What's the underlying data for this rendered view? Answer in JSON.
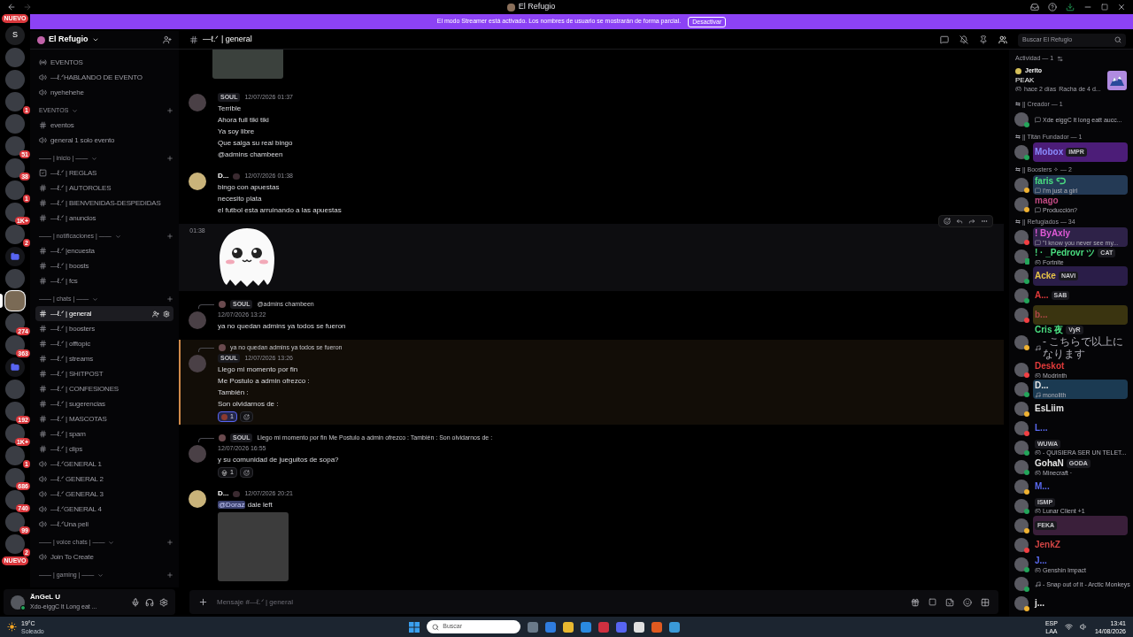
{
  "window": {
    "title": "El Refugio"
  },
  "banner": {
    "text": "El modo Streamer está activado. Los nombres de usuario se mostrarán de forma parcial.",
    "button": "Desactivar"
  },
  "rail": {
    "top_badge": "NUEVO",
    "bottom_badge": "NUEVO",
    "items": [
      {
        "kind": "letter",
        "label": "S",
        "selected": false
      },
      {
        "kind": "server",
        "selected": false
      },
      {
        "kind": "server",
        "selected": false
      },
      {
        "kind": "server",
        "badge": "1",
        "selected": false
      },
      {
        "kind": "server",
        "selected": false
      },
      {
        "kind": "server",
        "badge": "51",
        "selected": false
      },
      {
        "kind": "server",
        "badge": "38",
        "selected": false
      },
      {
        "kind": "server",
        "badge": "1",
        "selected": false
      },
      {
        "kind": "server",
        "badge": "1K+",
        "selected": false
      },
      {
        "kind": "server",
        "badge": "2",
        "selected": false
      },
      {
        "kind": "folder",
        "selected": false
      },
      {
        "kind": "server",
        "selected": false
      },
      {
        "kind": "server",
        "selected": true
      },
      {
        "kind": "server",
        "badge": "274",
        "selected": false
      },
      {
        "kind": "server",
        "badge": "363",
        "selected": false
      },
      {
        "kind": "folder",
        "selected": false
      },
      {
        "kind": "server",
        "selected": false
      },
      {
        "kind": "server",
        "badge": "192",
        "selected": false
      },
      {
        "kind": "server",
        "badge": "1K+",
        "selected": false
      },
      {
        "kind": "server",
        "badge": "1",
        "selected": false
      },
      {
        "kind": "server",
        "badge": "686",
        "selected": false
      },
      {
        "kind": "server",
        "badge": "740",
        "selected": false
      },
      {
        "kind": "server",
        "badge": "99",
        "selected": false
      },
      {
        "kind": "server",
        "badge": "2",
        "selected": false
      }
    ]
  },
  "sidebar": {
    "server_name": "El Refugio",
    "sections": [
      {
        "channels": [
          {
            "kind": "stage",
            "name": "EVENTOS",
            "selected": false
          },
          {
            "kind": "voice",
            "name": "—ℓ.ᐟHABLANDO DE EVENTO",
            "selected": false
          },
          {
            "kind": "voice",
            "name": "nyehehehe",
            "selected": false
          }
        ]
      },
      {
        "title": "EVENTOS",
        "channels": [
          {
            "kind": "text",
            "name": "eventos",
            "selected": false
          },
          {
            "kind": "voice",
            "name": "general 1 solo evento",
            "selected": false
          }
        ]
      },
      {
        "title": "—— | inicio | ——",
        "channels": [
          {
            "kind": "rules",
            "name": "—ℓ.ᐟ | REGLAS",
            "selected": false
          },
          {
            "kind": "text",
            "name": "—ℓ.ᐟ | AUTOROLES",
            "selected": false
          },
          {
            "kind": "text",
            "name": "—ℓ.ᐟ | BIENVENIDAS-DESPEDIDAS",
            "selected": false
          },
          {
            "kind": "text",
            "name": "—ℓ.ᐟ | anuncios",
            "selected": false
          }
        ]
      },
      {
        "title": "—— | notificaciones | ——",
        "channels": [
          {
            "kind": "text",
            "name": "—ℓ.ᐟ |encuesta",
            "selected": false
          },
          {
            "kind": "text",
            "name": "—ℓ.ᐟ | boosts",
            "selected": false
          },
          {
            "kind": "text",
            "name": "—ℓ.ᐟ | fcs",
            "selected": false
          }
        ]
      },
      {
        "title": "—— | chats | ——",
        "channels": [
          {
            "kind": "text",
            "name": "—ℓ.ᐟ | general",
            "selected": true
          },
          {
            "kind": "text",
            "name": "—ℓ.ᐟ | boosters",
            "selected": false
          },
          {
            "kind": "text",
            "name": "—ℓ.ᐟ | offtopic",
            "selected": false
          },
          {
            "kind": "text",
            "name": "—ℓ.ᐟ | streams",
            "selected": false
          },
          {
            "kind": "text",
            "name": "—ℓ.ᐟ | SHITPOST",
            "selected": false
          },
          {
            "kind": "text",
            "name": "—ℓ.ᐟ | CONFESIONES",
            "selected": false
          },
          {
            "kind": "text",
            "name": "—ℓ.ᐟ | sugerencias",
            "selected": false
          },
          {
            "kind": "text",
            "name": "—ℓ.ᐟ | MASCOTAS",
            "selected": false
          },
          {
            "kind": "text",
            "name": "—ℓ.ᐟ | spam",
            "selected": false
          },
          {
            "kind": "text",
            "name": "—ℓ.ᐟ | clips",
            "selected": false
          },
          {
            "kind": "voice",
            "name": "—ℓ.ᐟGENERAL 1",
            "selected": false
          },
          {
            "kind": "voice",
            "name": "—ℓ.ᐟ GENERAL 2",
            "selected": false
          },
          {
            "kind": "voice",
            "name": "—ℓ.ᐟ GENERAL 3",
            "selected": false
          },
          {
            "kind": "voice",
            "name": "—ℓ.ᐟGENERAL 4",
            "selected": false
          },
          {
            "kind": "voice",
            "name": "—ℓ.ᐟUna peli",
            "selected": false
          }
        ]
      },
      {
        "title": "—— | voice chats | ——",
        "channels": [
          {
            "kind": "voice",
            "name": "Join To Create",
            "selected": false
          }
        ]
      },
      {
        "title": "—— | gaming | ——"
      }
    ]
  },
  "user": {
    "name": "ÄnGeL U",
    "status": "Xdo-eiggC lt Long eat ..."
  },
  "chat": {
    "channel": "—ℓ.ᐟ | general",
    "placeholder": "Mensaje #—ℓ.ᐟ | general",
    "messages": [
      {
        "kind": "image"
      },
      {
        "kind": "message",
        "highlighted": false,
        "hovered": false,
        "tag": "SOUL",
        "time": "12/07/2026 01:37",
        "lines": [
          "Terrible",
          "Ahora full tiki tiki",
          "Ya soy libre",
          "Que salga su real bingo",
          "@admins chambeen"
        ]
      },
      {
        "kind": "message",
        "highlighted": false,
        "hovered": false,
        "author": "D...",
        "time": "12/07/2026 01:38",
        "lines": [
          "bingo con apuestas",
          "necesito plata",
          "el futbol esta arruinando a las apuestas"
        ]
      },
      {
        "kind": "sticker",
        "highlighted": false,
        "hovered": true,
        "time": "01:38"
      },
      {
        "kind": "message",
        "highlighted": false,
        "hovered": false,
        "reply": {
          "tag": "SOUL",
          "text": "@admins chambeen"
        },
        "time": "12/07/2026 13:22",
        "lines": [
          "ya no quedan admins ya todos se fueron"
        ]
      },
      {
        "kind": "message",
        "highlighted": true,
        "hovered": false,
        "reply": {
          "text": "ya no quedan admins ya todos se fueron"
        },
        "tag": "SOUL",
        "time": "12/07/2026 13:26",
        "lines": [
          "Llego mi momento por fin",
          "Me Postulo a admin ofrezco :",
          "También :",
          "Son olvidarnos de :"
        ],
        "reactions": [
          {
            "kind": "custom",
            "count": "1",
            "selected": true
          }
        ]
      },
      {
        "kind": "message",
        "highlighted": false,
        "hovered": false,
        "reply": {
          "tag": "SOUL",
          "text": "Llego mi momento por fin Me Postulo a admin ofrezco :  También :  Son olvidarnos de :"
        },
        "time": "12/07/2026 16:55",
        "lines": [
          "y su comunidad de jueguitos de sopa?"
        ],
        "reactions": [
          {
            "kind": "skull",
            "count": "1",
            "selected": false
          }
        ]
      },
      {
        "kind": "message",
        "highlighted": false,
        "hovered": false,
        "author": "D...",
        "time": "12/07/2026 20:21",
        "mention": "@Doraz",
        "lines": [
          "dale left"
        ],
        "attachments": [
          {
            "kind": "photo"
          }
        ]
      }
    ]
  },
  "members": {
    "search_placeholder": "Buscar El Refugio",
    "activity": {
      "heading": "Actividad — 1",
      "name": "Jerito",
      "game": "PEAK",
      "detail": "hace 2 días",
      "streak": "Racha de 4 d..."
    },
    "groups": [
      {
        "heading": "⇆ || Creador — 1",
        "members": [
          {
            "presence": {
              "kind": "dot",
              "color": "#23a55a"
            },
            "activity": {
              "kind": "custom",
              "text": "Xde eiggC lt long eatt aucc..."
            }
          }
        ]
      },
      {
        "heading": "⇆ || Titán Fundador — 1",
        "members": [
          {
            "name": "Mobox",
            "color": "#8a8cff",
            "tag": "IMPR",
            "presence": {
              "kind": "dot",
              "color": "#23a55a"
            },
            "nameplate": {
              "color": "#4c1d78"
            }
          }
        ]
      },
      {
        "heading": "⇆ || Boosters ✧ — 2",
        "members": [
          {
            "name": "faris ᑦᑐ",
            "color": "#4ade80",
            "presence": {
              "kind": "dot",
              "color": "#f0b232"
            },
            "activity": {
              "kind": "custom",
              "text": "I'm just a girl"
            },
            "nameplate": {
              "color": "#243a55"
            }
          },
          {
            "name": "mago",
            "color": "#c04a82",
            "presence": {
              "kind": "dot",
              "color": "#f0b232"
            },
            "activity": {
              "kind": "custom",
              "text": "Producción?"
            }
          }
        ]
      },
      {
        "heading": "⇆ || Refugiados — 34",
        "members": [
          {
            "name": "! ByAxly",
            "color": "#e05ad6",
            "presence": {
              "kind": "dot",
              "color": "#f23f43"
            },
            "activity": {
              "kind": "custom",
              "text": "\"I know you never see my..."
            },
            "nameplate": {
              "color": "#2e2248"
            }
          },
          {
            "name": "! · _Pedrovr ツ",
            "color": "#4ade80",
            "tag": "CAT",
            "presence": {
              "kind": "mobile",
              "color": "#23a55a"
            },
            "activity": {
              "kind": "game",
              "text": "Fortnite"
            }
          },
          {
            "name": "Acke",
            "color": "#e8c547",
            "tag": "NAVI",
            "presence": {
              "kind": "dot",
              "color": "#23a55a"
            },
            "nameplate": {
              "color": "#2a1d48"
            }
          },
          {
            "name": "A...",
            "color": "#e03a3a",
            "tag": "SAB",
            "presence": {
              "kind": "dot",
              "color": "#23a55a"
            }
          },
          {
            "name": "b...",
            "color": "#b04848",
            "presence": {
              "kind": "dot",
              "color": "#f23f43"
            },
            "nameplate": {
              "color": "#3a3410"
            }
          },
          {
            "name": "Cris 夜",
            "color": "#4ade80",
            "tag": "VyR",
            "presence": {
              "kind": "dot",
              "color": "#f0b232"
            },
            "activity": {
              "kind": "music",
              "text": "- こちらで以上になります"
            }
          },
          {
            "name": "Deskot",
            "color": "#e03a3a",
            "presence": {
              "kind": "dot",
              "color": "#f23f43"
            },
            "activity": {
              "kind": "game",
              "text": "Modrinth"
            }
          },
          {
            "name": "D...",
            "color": "#e5e5e5",
            "presence": {
              "kind": "dot",
              "color": "#23a55a"
            },
            "activity": {
              "kind": "music",
              "text": "monolith"
            },
            "nameplate": {
              "color": "#1b3a52"
            }
          },
          {
            "name": "EsLiim",
            "color": "#e5e5e5",
            "presence": {
              "kind": "dot",
              "color": "#f0b232"
            }
          },
          {
            "name": "L...",
            "color": "#5a6af0",
            "presence": {
              "kind": "dot",
              "color": "#f23f43"
            }
          },
          {
            "tag": "WUWA",
            "presence": {
              "kind": "dot",
              "color": "#23a55a"
            },
            "activity": {
              "kind": "game",
              "text": "- QUISIERA SER UN TELET..."
            }
          },
          {
            "name": "GohaN",
            "color": "#e5e5e5",
            "tag": "GODA",
            "presence": {
              "kind": "dot",
              "color": "#23a55a"
            },
            "activity": {
              "kind": "game",
              "text": "Minecraft ·"
            }
          },
          {
            "name": "M...",
            "color": "#5a6af0",
            "presence": {
              "kind": "dot",
              "color": "#f0b232"
            }
          },
          {
            "tag": "ISMP",
            "presence": {
              "kind": "dot",
              "color": "#23a55a"
            },
            "activity": {
              "kind": "game",
              "text": "Lunar Client +1"
            }
          },
          {
            "tag": "FEKA",
            "presence": {
              "kind": "dot",
              "color": "#f0b232"
            },
            "nameplate": {
              "color": "#3a1f3a"
            }
          },
          {
            "name": "JenkZ",
            "color": "#d04444",
            "presence": {
              "kind": "dot",
              "color": "#f23f43"
            }
          },
          {
            "name": "J...",
            "color": "#5a6af0",
            "presence": {
              "kind": "dot",
              "color": "#23a55a"
            },
            "activity": {
              "kind": "game",
              "text": "Genshin Impact"
            }
          },
          {
            "presence": {
              "kind": "dot",
              "color": "#23a55a"
            },
            "activity": {
              "kind": "music",
              "text": "- Snap out of it - Arctic Monkeys"
            }
          },
          {
            "name": "j...",
            "color": "#e5e5e5",
            "presence": {
              "kind": "dot",
              "color": "#f0b232"
            }
          }
        ]
      }
    ]
  },
  "taskbar": {
    "temperature": "19°C",
    "weather": "Soleado",
    "search_placeholder": "Buscar",
    "language": "ESP",
    "layout": "LAA",
    "time": "13:41",
    "date": "14/08/2026"
  }
}
